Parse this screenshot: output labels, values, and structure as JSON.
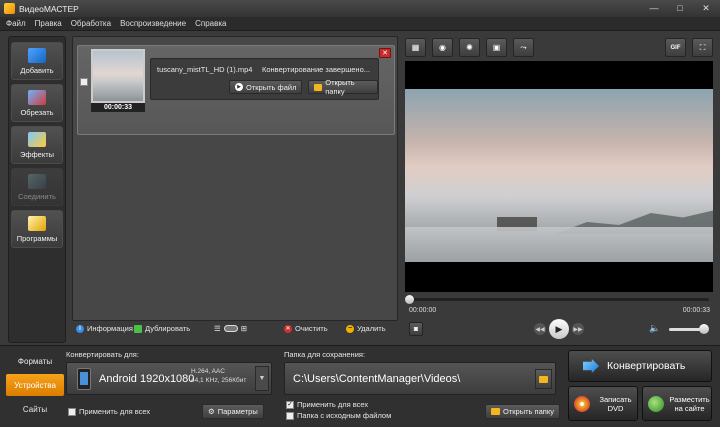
{
  "window": {
    "title": "ВидеоМАСТЕР",
    "minimize": "—",
    "maximize": "□",
    "close": "✕"
  },
  "menu": [
    "Файл",
    "Правка",
    "Обработка",
    "Воспроизведение",
    "Справка"
  ],
  "sidebar": {
    "items": [
      {
        "label": "Добавить",
        "icon": "film-add-icon",
        "enabled": true
      },
      {
        "label": "Обрезать",
        "icon": "scissors-icon",
        "enabled": true
      },
      {
        "label": "Эффекты",
        "icon": "magic-wand-icon",
        "enabled": true
      },
      {
        "label": "Соединить",
        "icon": "join-icon",
        "enabled": false
      },
      {
        "label": "Программы",
        "icon": "programs-icon",
        "enabled": true
      }
    ]
  },
  "file": {
    "name": "tuscany_mistTL_HD (1).mp4",
    "status": "Конвертирование завершено...",
    "duration": "00:00:33",
    "open_file": "Открыть файл",
    "open_folder": "Открыть папку",
    "close_symbol": "✕"
  },
  "file_toolbar": {
    "info": "Информация",
    "duplicate": "Дублировать",
    "clear": "Очистить",
    "delete": "Удалить"
  },
  "player": {
    "tools": [
      "crop-icon",
      "rotate-icon",
      "brightness-icon",
      "enhance-icon",
      "speed-icon"
    ],
    "gif_label": "GIF",
    "time_current": "00:00:00",
    "time_total": "00:00:33",
    "progress": 0,
    "volume": 0.85
  },
  "tabs": [
    "Форматы",
    "Устройства",
    "Сайты"
  ],
  "active_tab": "Устройства",
  "convert_for": {
    "label": "Конвертировать для:",
    "profile": "Android 1920x1080",
    "specs_line1": "H.264, AAC",
    "specs_line2": "44,1 KHz, 256Кбит",
    "apply_all": "Применить для всех",
    "params": "Параметры"
  },
  "save_folder": {
    "label": "Папка для сохранения:",
    "path": "C:\\Users\\ContentManager\\Videos\\",
    "apply_all": "Применить для всех",
    "source_folder": "Папка с исходным файлом",
    "open_folder": "Открыть папку"
  },
  "actions": {
    "convert": "Конвертировать",
    "burn_dvd": "Записать DVD",
    "publish": "Разместить на сайте"
  },
  "colors": {
    "accent": "#f7a21b",
    "background": "#3a3a3a"
  }
}
